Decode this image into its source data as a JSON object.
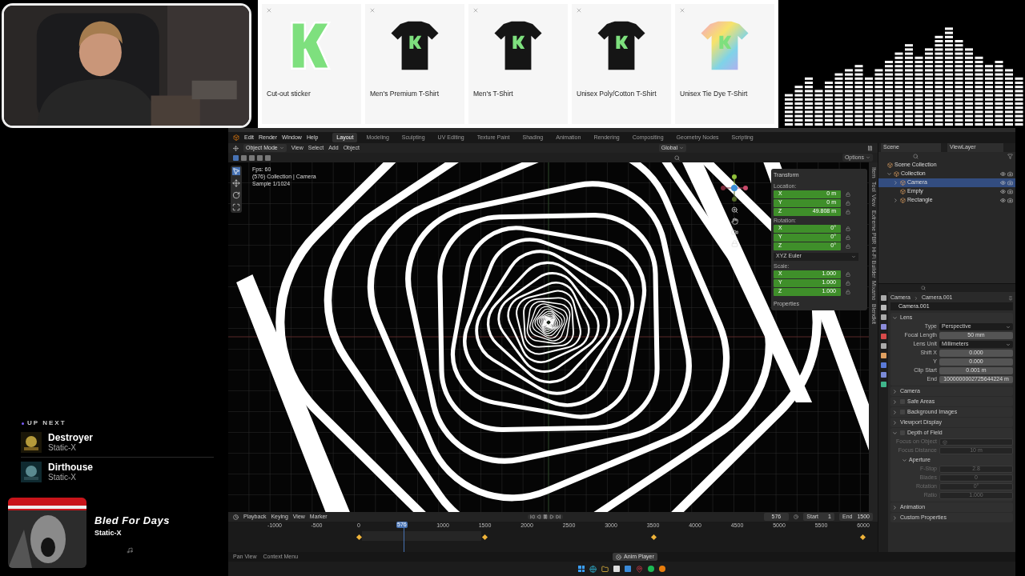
{
  "merch": [
    {
      "name": "Cut-out sticker",
      "kind": "sticker"
    },
    {
      "name": "Men's Premium T-Shirt",
      "kind": "black_shirt"
    },
    {
      "name": "Men's T-Shirt",
      "kind": "black_shirt"
    },
    {
      "name": "Unisex Poly/Cotton T-Shirt",
      "kind": "black_shirt"
    },
    {
      "name": "Unisex Tie Dye T-Shirt",
      "kind": "tiedye_shirt"
    }
  ],
  "up_next": {
    "heading": "UP NEXT",
    "tracks": [
      {
        "title": "Destroyer",
        "artist": "Static-X"
      },
      {
        "title": "Dirthouse",
        "artist": "Static-X"
      }
    ]
  },
  "now_playing": {
    "title": "Bled For Days",
    "artist": "Static-X"
  },
  "blender": {
    "menu": [
      "Edit",
      "Render",
      "Window",
      "Help"
    ],
    "workspaces": [
      {
        "label": "Layout",
        "selected": true
      },
      {
        "label": "Modeling",
        "selected": false
      },
      {
        "label": "Sculpting",
        "selected": false
      },
      {
        "label": "UV Editing",
        "selected": false
      },
      {
        "label": "Texture Paint",
        "selected": false
      },
      {
        "label": "Shading",
        "selected": false
      },
      {
        "label": "Animation",
        "selected": false
      },
      {
        "label": "Rendering",
        "selected": false
      },
      {
        "label": "Compositing",
        "selected": false
      },
      {
        "label": "Geometry Nodes",
        "selected": false
      },
      {
        "label": "Scripting",
        "selected": false
      }
    ],
    "header": {
      "mode": "Object Mode",
      "menus": [
        "View",
        "Select",
        "Add",
        "Object"
      ],
      "orientation": "Global",
      "options": "Options"
    },
    "viewport_info": [
      "Fps: 60",
      "(576) Collection | Camera",
      "Sample 1/1024"
    ],
    "transform": {
      "title": "Transform",
      "groups": [
        {
          "label": "Location:",
          "values": [
            {
              "axis": "X",
              "value": "0 m"
            },
            {
              "axis": "Y",
              "value": "0 m"
            },
            {
              "axis": "Z",
              "value": "49.808 m"
            }
          ]
        },
        {
          "label": "Rotation:",
          "values": [
            {
              "axis": "X",
              "value": "0°"
            },
            {
              "axis": "Y",
              "value": "0°"
            },
            {
              "axis": "Z",
              "value": "0°"
            }
          ],
          "mode": "XYZ Euler"
        },
        {
          "label": "Scale:",
          "values": [
            {
              "axis": "X",
              "value": "1.000"
            },
            {
              "axis": "Y",
              "value": "1.000"
            },
            {
              "axis": "Z",
              "value": "1.000"
            }
          ]
        }
      ],
      "footer": "Properties"
    },
    "sidebar_tabs": [
      "Item",
      "Tool",
      "View",
      "Extreme PBR",
      "Hi-Fi Builder",
      "Mixamo",
      "Blendkit"
    ],
    "outliner": {
      "scene": "Scene",
      "view_layer": "ViewLayer",
      "tree": [
        {
          "label": "Scene Collection",
          "selected": false,
          "children": [
            {
              "label": "Collection",
              "selected": false,
              "expanded": true,
              "children": [
                {
                  "label": "Camera",
                  "selected": true,
                  "expanded": false
                },
                {
                  "label": "Empty",
                  "selected": false
                },
                {
                  "label": "Rectangle",
                  "selected": false,
                  "expanded": false
                }
              ]
            }
          ]
        }
      ]
    },
    "properties": {
      "breadcrumb": [
        "Camera",
        "Camera.001"
      ],
      "datablock": "Camera.001",
      "sections": [
        {
          "title": "Lens",
          "expanded": true,
          "fields": [
            {
              "label": "Type",
              "value": "Perspective",
              "kind": "dropdown",
              "disabled": false
            },
            {
              "label": "Focal Length",
              "value": "50 mm",
              "kind": "number",
              "disabled": false
            },
            {
              "label": "Lens Unit",
              "value": "Millimeters",
              "kind": "dropdown",
              "disabled": false
            },
            {
              "label": "Shift X",
              "value": "0.000",
              "kind": "number",
              "disabled": false
            },
            {
              "label": "Y",
              "value": "0.000",
              "kind": "number",
              "disabled": false
            },
            {
              "label": "Clip Start",
              "value": "0.001 m",
              "kind": "number",
              "disabled": false
            },
            {
              "label": "End",
              "value": "1000000002725644224 m",
              "kind": "number",
              "disabled": false
            }
          ]
        },
        {
          "title": "Camera",
          "expanded": false
        },
        {
          "title": "Safe Areas",
          "expanded": false,
          "checked": false
        },
        {
          "title": "Background Images",
          "expanded": false,
          "checked": false
        },
        {
          "title": "Viewport Display",
          "expanded": false
        },
        {
          "title": "Depth of Field",
          "expanded": true,
          "checked": false,
          "fields": [
            {
              "label": "Focus on Object",
              "kind": "object",
              "disabled": true
            },
            {
              "label": "Focus Distance",
              "value": "10 m",
              "kind": "number",
              "disabled": true
            },
            {
              "label": "Aperture",
              "kind": "subheader",
              "expanded": true
            },
            {
              "label": "F-Stop",
              "value": "2.8",
              "kind": "number",
              "disabled": true
            },
            {
              "label": "Blades",
              "value": "0",
              "kind": "number",
              "disabled": true
            },
            {
              "label": "Rotation",
              "value": "0°",
              "kind": "number",
              "disabled": true
            },
            {
              "label": "Ratio",
              "value": "1.000",
              "kind": "number",
              "disabled": true
            }
          ]
        },
        {
          "title": "Animation",
          "expanded": false
        },
        {
          "title": "Custom Properties",
          "expanded": false
        }
      ]
    },
    "timeline": {
      "menus": [
        "Playback",
        "Keying",
        "View",
        "Marker"
      ],
      "current_frame": "576",
      "playhead_frame": "576",
      "start_label": "Start",
      "start": "1",
      "end_label": "End",
      "end": "1500",
      "ticks": [
        "-1000",
        "-500",
        "0",
        "1000",
        "1500",
        "2000",
        "2500",
        "3000",
        "3500",
        "4000",
        "4500",
        "5000",
        "5500",
        "6000"
      ]
    },
    "status": [
      "Pan View",
      "Context Menu"
    ],
    "notification": "Anim Player"
  }
}
